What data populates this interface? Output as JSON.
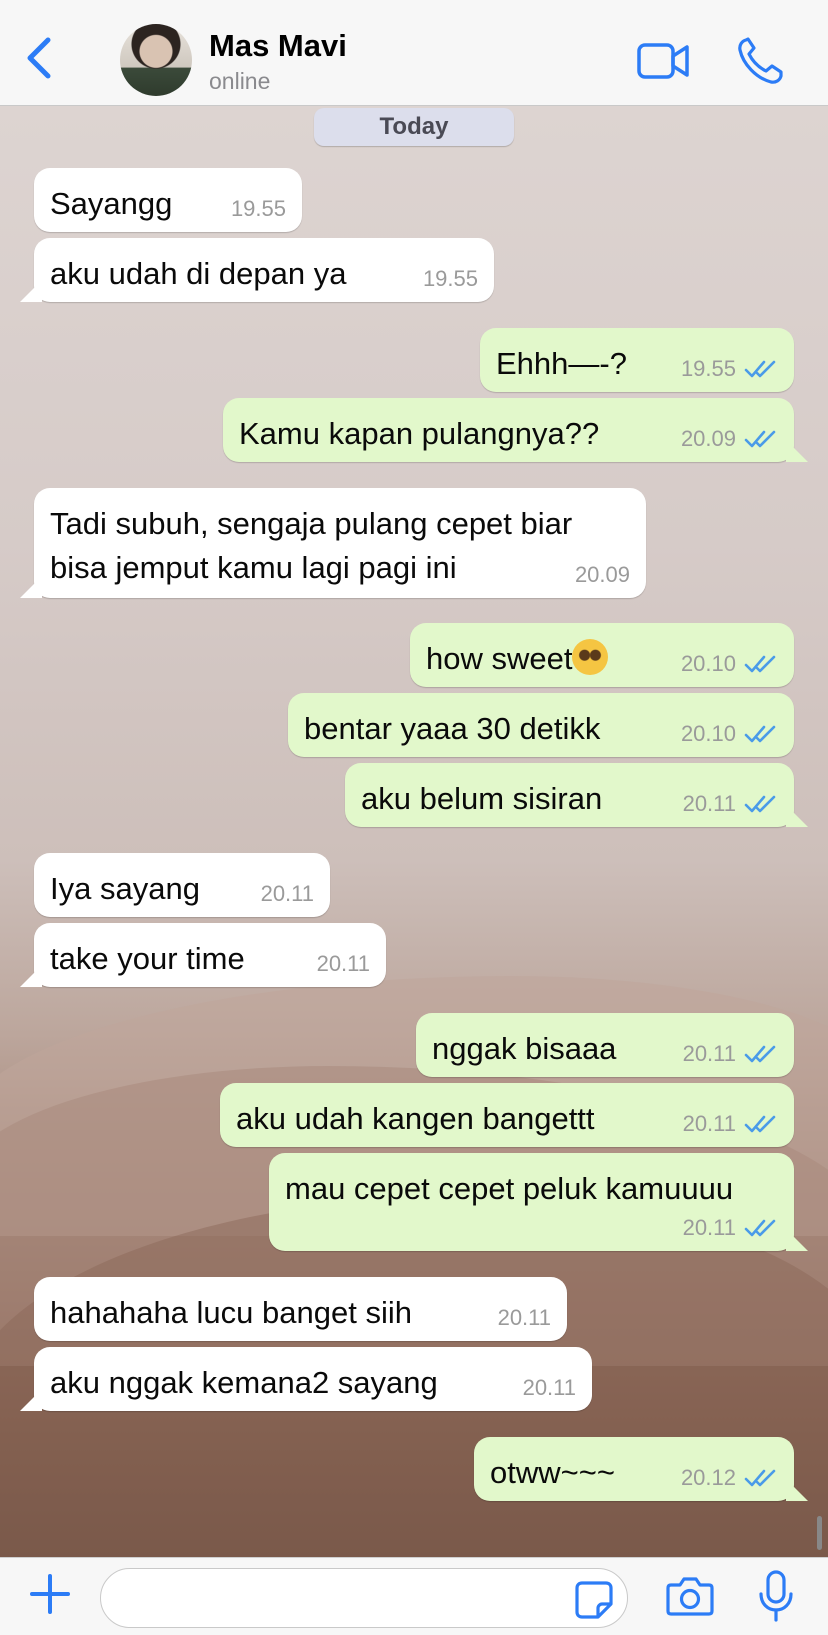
{
  "header": {
    "contact_name": "Mas Mavi",
    "status": "online",
    "accent": "#2c7cf6"
  },
  "day_label": "Today",
  "messages": [
    {
      "dir": "in",
      "text": "Sayangg",
      "time": "19.55"
    },
    {
      "dir": "in",
      "text": "aku udah di depan ya",
      "time": "19.55"
    },
    {
      "dir": "out",
      "text": "Ehhh—-?",
      "time": "19.55",
      "read": true
    },
    {
      "dir": "out",
      "text": "Kamu kapan pulangnya??",
      "time": "20.09",
      "read": true
    },
    {
      "dir": "in",
      "text": "Tadi subuh, sengaja pulang cepet biar\nbisa jemput kamu lagi pagi ini",
      "time": "20.09"
    },
    {
      "dir": "out",
      "text": "how sweet",
      "emoji": "pleading-face-emoji",
      "time": "20.10",
      "read": true
    },
    {
      "dir": "out",
      "text": "bentar yaaa 30 detikk",
      "time": "20.10",
      "read": true
    },
    {
      "dir": "out",
      "text": "aku belum sisiran",
      "time": "20.11",
      "read": true
    },
    {
      "dir": "in",
      "text": "Iya sayang",
      "time": "20.11"
    },
    {
      "dir": "in",
      "text": "take your time",
      "time": "20.11"
    },
    {
      "dir": "out",
      "text": "nggak bisaaa",
      "time": "20.11",
      "read": true
    },
    {
      "dir": "out",
      "text": "aku udah kangen bangettt",
      "time": "20.11",
      "read": true
    },
    {
      "dir": "out",
      "text": "mau cepet cepet peluk kamuuuu",
      "time": "20.11",
      "read": true
    },
    {
      "dir": "in",
      "text": "hahahaha lucu banget siih",
      "time": "20.11"
    },
    {
      "dir": "in",
      "text": "aku nggak kemana2 sayang",
      "time": "20.11"
    },
    {
      "dir": "out",
      "text": "otww~~~",
      "time": "20.12",
      "read": true
    }
  ],
  "composer": {
    "value": "",
    "placeholder": ""
  },
  "icons": {
    "back": "chevron-left-icon",
    "video": "video-camera-icon",
    "call": "phone-icon",
    "add": "plus-icon",
    "sticker": "sticker-icon",
    "camera": "camera-icon",
    "mic": "microphone-icon",
    "read_receipt": "double-check-icon"
  },
  "colors": {
    "incoming_bubble": "#ffffff",
    "outgoing_bubble": "#e2f8cb",
    "read_tick": "#4a9be8"
  }
}
